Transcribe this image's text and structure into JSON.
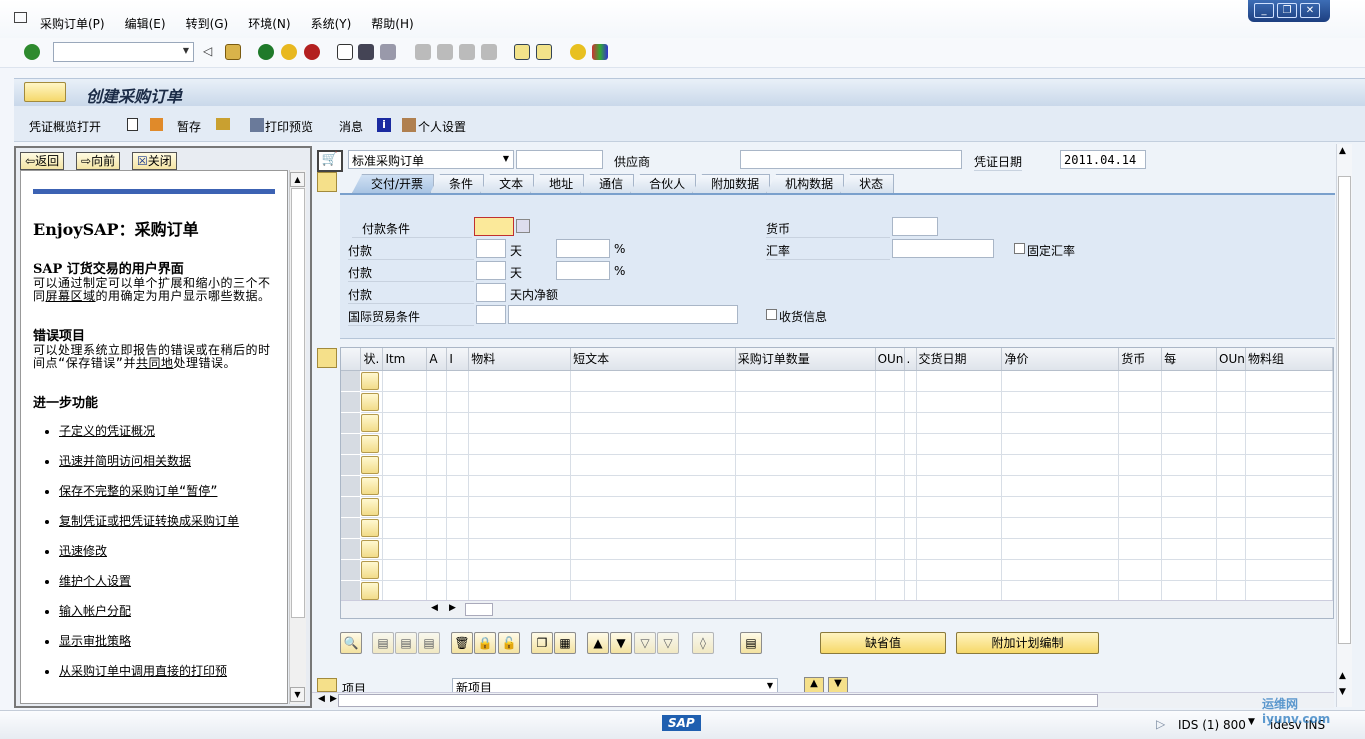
{
  "menu": [
    "采购订单(P)",
    "编辑(E)",
    "转到(G)",
    "环境(N)",
    "系统(Y)",
    "帮助(H)"
  ],
  "window_controls": [
    "_",
    "❐",
    "✕"
  ],
  "command_field": {
    "value": ""
  },
  "title": "创建采购订单",
  "app_toolbar": {
    "doc_overview": "凭证概览打开",
    "hold": "暂存",
    "print_preview": "打印预览",
    "messages": "消息",
    "personal_settings": "个人设置"
  },
  "help_panel": {
    "tabs": [
      "返回",
      "向前",
      "关闭"
    ],
    "heading": "EnjoySAP：采购订单",
    "sections": [
      {
        "title": "SAP 订货交易的用户界面",
        "text_a": "可以通过制定可以单个扩展和缩小的三个不同",
        "link": "屏幕区域",
        "text_b": "的用确定为用户显示哪些数据。"
      },
      {
        "title": "错误项目",
        "text_a": "可以处理系统立即报告的错误或在稍后的时间点“保存错误”并",
        "link": "共同地",
        "text_b": "处理错误。"
      }
    ],
    "further_title": "进一步功能",
    "links": [
      "子定义的凭证概况",
      "迅速并简明访问相关数据",
      "保存不完整的采购订单“暂停”",
      "复制凭证或把凭证转换成采购订单",
      "迅速修改",
      "维护个人设置",
      "输入帐户分配",
      "显示审批策略",
      "从采购订单中调用直接的打印预"
    ]
  },
  "header": {
    "order_type": "标准采购订单",
    "order_no": "",
    "vendor_label": "供应商",
    "vendor": "",
    "doc_date_label": "凭证日期",
    "doc_date": "2011.04.14"
  },
  "tabs": [
    "交付/开票",
    "条件",
    "文本",
    "地址",
    "通信",
    "合伙人",
    "附加数据",
    "机构数据",
    "状态"
  ],
  "delivery_tab": {
    "payment_terms": "付款条件",
    "payment": "付款",
    "days": "天",
    "percent": "%",
    "net_days": "天内净额",
    "incoterms": "国际贸易条件",
    "currency": "货币",
    "exchange_rate": "汇率",
    "fixed_rate": "固定汇率",
    "gr_message": "收货信息"
  },
  "items_table": {
    "columns": [
      "",
      "状.",
      "Itm",
      "A",
      "I",
      "物料",
      "短文本",
      "采购订单数量",
      "OUn",
      ".",
      "交货日期",
      "净价",
      "货币",
      "每",
      "OUn",
      "物料组"
    ],
    "row_count": 11
  },
  "grid_buttons": {
    "default_values": "缺省值",
    "additional_planning": "附加计划编制"
  },
  "item_selector": {
    "label": "项目",
    "value": "新项目"
  },
  "status_bar": {
    "logo": "SAP",
    "system": "IDS (1) 800",
    "server": "idesv",
    "mode": "INS",
    "watermark": "运维网 iyunv.com"
  }
}
